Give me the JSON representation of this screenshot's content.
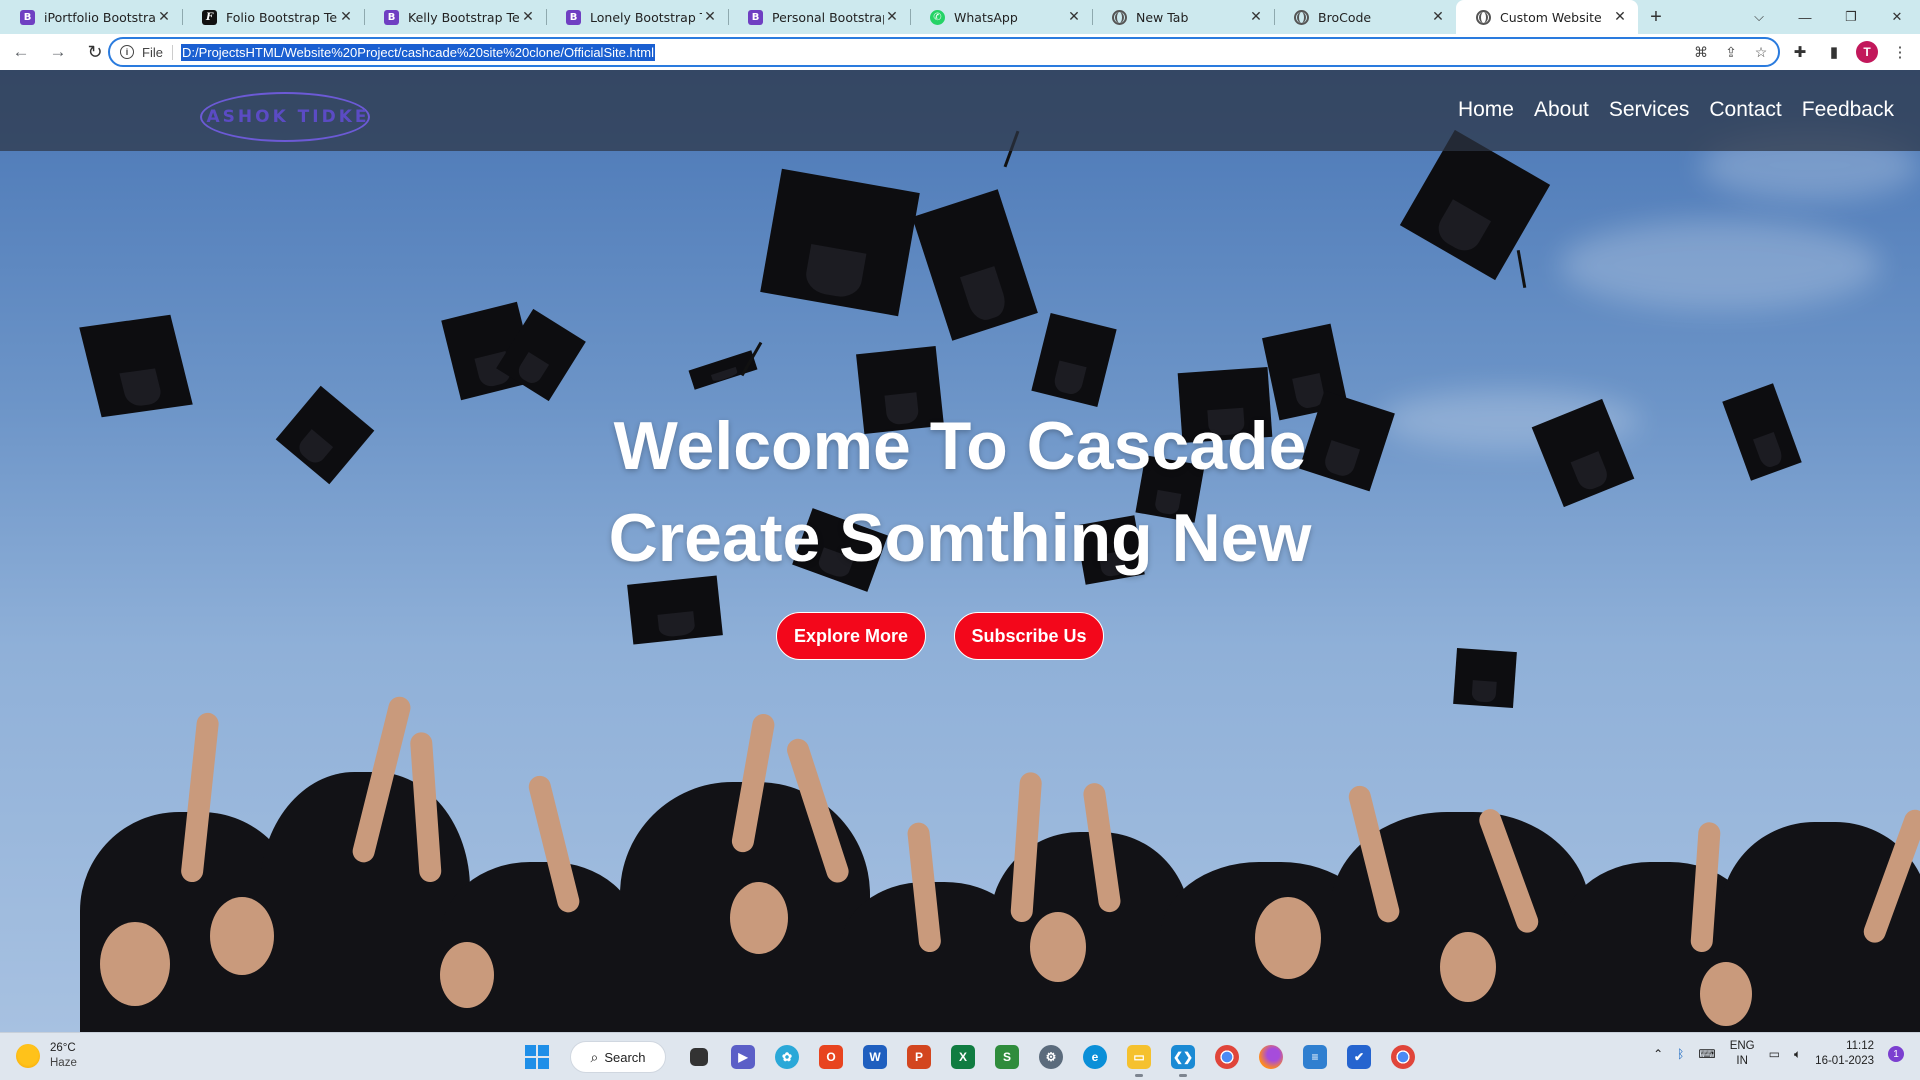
{
  "browser": {
    "tabs": [
      {
        "title": "iPortfolio Bootstrap Te",
        "favicon": "bootstrap-icon",
        "favicon_letter": "B"
      },
      {
        "title": "Folio Bootstrap Templ",
        "favicon": "folio-icon",
        "favicon_letter": "F"
      },
      {
        "title": "Kelly Bootstrap Templ",
        "favicon": "bootstrap-icon",
        "favicon_letter": "B"
      },
      {
        "title": "Lonely Bootstrap Tem",
        "favicon": "bootstrap-icon",
        "favicon_letter": "B"
      },
      {
        "title": "Personal Bootstrap Te",
        "favicon": "bootstrap-icon",
        "favicon_letter": "B"
      },
      {
        "title": "WhatsApp",
        "favicon": "whatsapp-icon",
        "favicon_letter": ""
      },
      {
        "title": "New Tab",
        "favicon": "chrome-icon",
        "favicon_letter": ""
      },
      {
        "title": "BroCode",
        "favicon": "globe-icon",
        "favicon_letter": ""
      },
      {
        "title": "Custom Website",
        "favicon": "globe-icon",
        "favicon_letter": "",
        "active": true
      }
    ],
    "omnibox": {
      "scheme_label": "File",
      "url": "D:/ProjectsHTML/Website%20Project/cashcade%20site%20clone/OfficialSite.html"
    },
    "profile_initial": "T"
  },
  "site": {
    "logo_text": "ASHOK TIDKE",
    "menu": [
      "Home",
      "About",
      "Services",
      "Contact",
      "Feedback"
    ],
    "hero": {
      "line1": "Welcome To Cascade",
      "line2": "Create Somthing New",
      "buttons": [
        "Explore More",
        "Subscribe Us"
      ]
    },
    "colors": {
      "button_red": "#f3071b",
      "nav_overlay": "#2d3444",
      "accent_logo": "#5b4bc4"
    }
  },
  "taskbar": {
    "weather": {
      "temp": "26°C",
      "condition": "Haze"
    },
    "search_label": "Search",
    "pinned_apps": [
      "start-icon",
      "search",
      "task-view-icon",
      "teams-icon",
      "widgets-icon",
      "office-icon",
      "word-icon",
      "powerpoint-icon",
      "excel-icon",
      "sublime-icon",
      "settings-icon",
      "edge-icon",
      "file-explorer-icon",
      "vscode-icon",
      "chrome-icon",
      "firefox-icon",
      "notepad-icon",
      "todo-icon",
      "chrome-alt-icon"
    ],
    "tray": {
      "lang_top": "ENG",
      "lang_bottom": "IN",
      "time": "11:12",
      "date": "16-01-2023",
      "notification_count": "1"
    }
  }
}
